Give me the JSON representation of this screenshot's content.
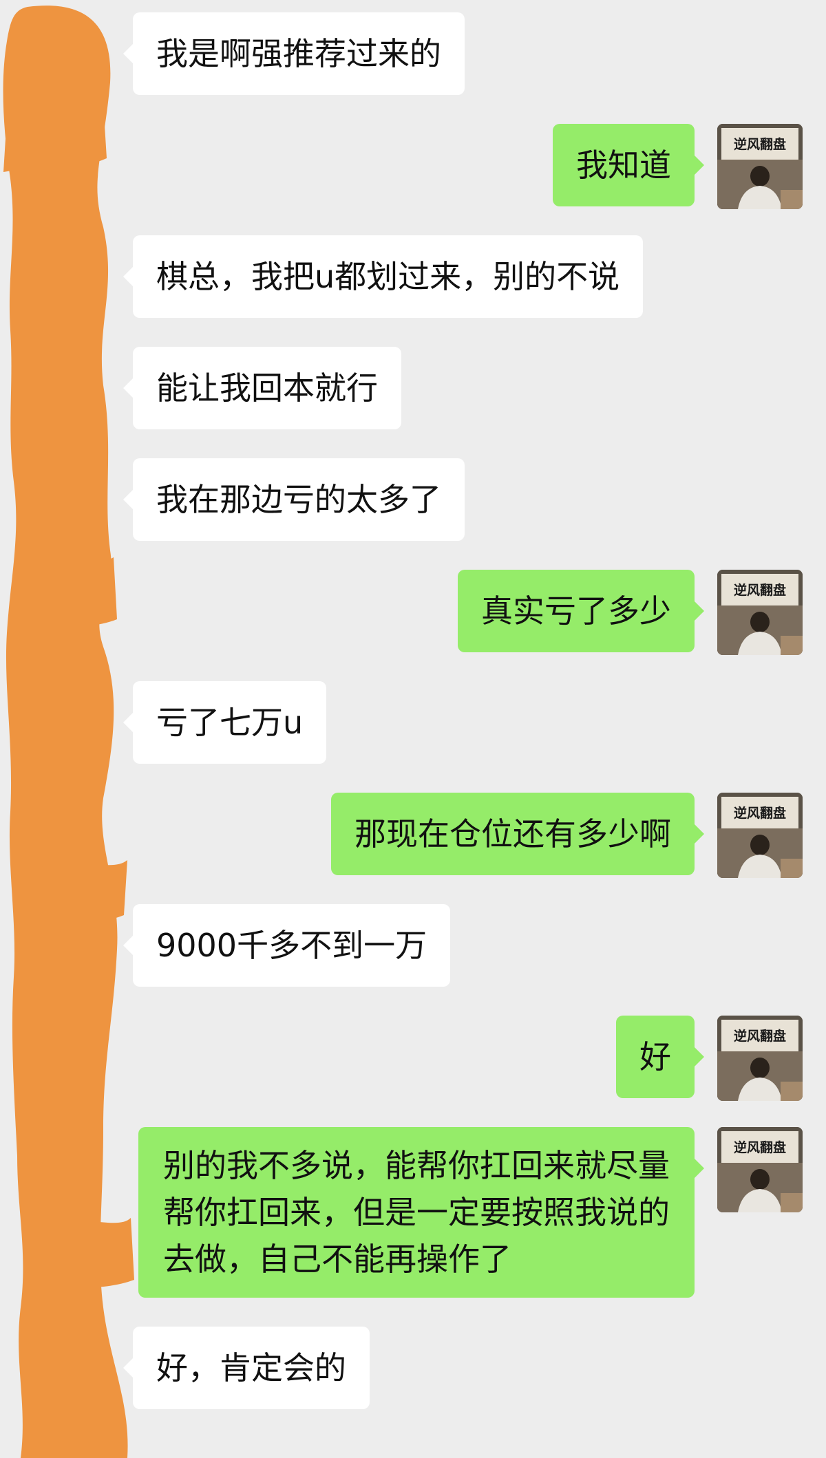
{
  "messages": [
    {
      "side": "in",
      "text": "我是啊强推荐过来的"
    },
    {
      "side": "out",
      "text": "我知道"
    },
    {
      "side": "in",
      "text": "棋总，我把u都划过来，别的不说"
    },
    {
      "side": "in",
      "text": "能让我回本就行"
    },
    {
      "side": "in",
      "text": "我在那边亏的太多了"
    },
    {
      "side": "out",
      "text": "真实亏了多少"
    },
    {
      "side": "in",
      "text": "亏了七万u"
    },
    {
      "side": "out",
      "text": "那现在仓位还有多少啊"
    },
    {
      "side": "in",
      "text": "9000千多不到一万"
    },
    {
      "side": "out",
      "text": "好"
    },
    {
      "side": "out",
      "text": "别的我不多说，能帮你扛回来就尽量帮你扛回来，但是一定要按照我说的去做，自己不能再操作了"
    },
    {
      "side": "in",
      "text": "好，肯定会的"
    }
  ],
  "avatar": {
    "logo_text": "逆风翻盘"
  },
  "colors": {
    "background": "#ededed",
    "incoming_bubble": "#ffffff",
    "outgoing_bubble": "#95ec69",
    "redaction": "#ee9440"
  }
}
